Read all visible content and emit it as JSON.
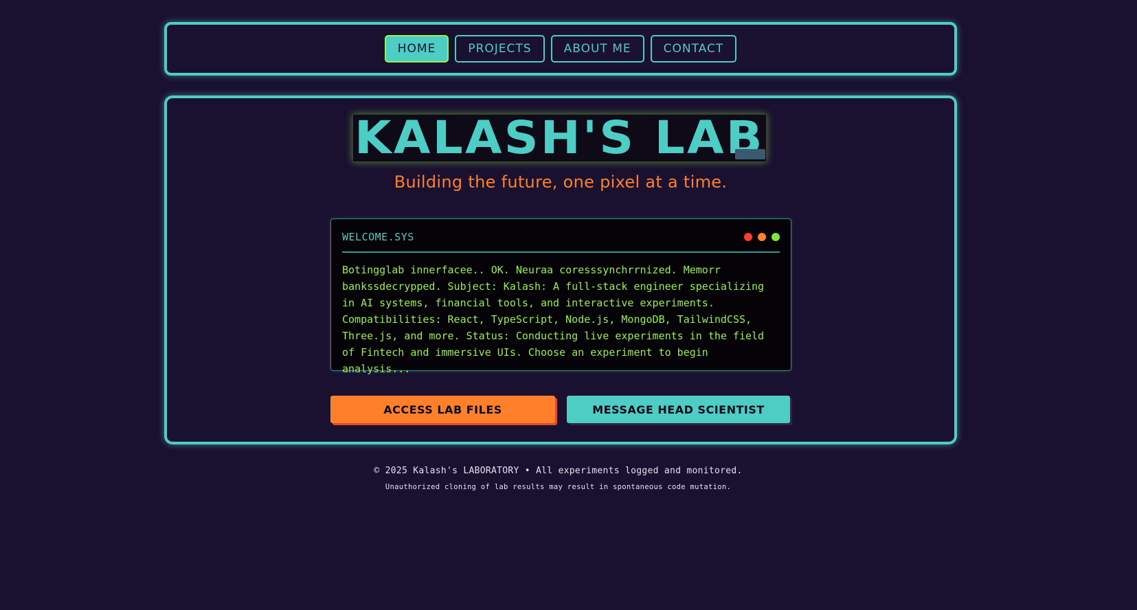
{
  "nav": {
    "items": [
      {
        "label": "HOME",
        "active": true
      },
      {
        "label": "PROJECTS",
        "active": false
      },
      {
        "label": "ABOUT ME",
        "active": false
      },
      {
        "label": "CONTACT",
        "active": false
      }
    ]
  },
  "hero": {
    "title": "KALASH'S LAB",
    "tagline": "Building the future, one pixel at a time."
  },
  "terminal": {
    "title": "WELCOME.SYS",
    "dot_colors": [
      "#ff3b30",
      "#ff7f2a",
      "#7ee83a"
    ],
    "body": "Botingglab innerfacee.. OK. Neuraa coresssynchrrnized. Memorr bankssdecrypped. Subject: Kalash: A full-stack engineer specializing in AI systems, financial tools, and interactive experiments. Compatibilities: React, TypeScript, Node.js, MongoDB, TailwindCSS, Three.js, and more. Status: Conducting live experiments in the field of Fintech and immersive UIs. Choose an experiment to begin analysis..."
  },
  "actions": {
    "primary_label": "ACCESS LAB FILES",
    "secondary_label": "MESSAGE HEAD SCIENTIST"
  },
  "footer": {
    "copyright": "© 2025 Kalash's LABORATORY • All experiments logged and monitored.",
    "notice": "Unauthorized cloning of lab results may result in spontaneous code mutation."
  },
  "colors": {
    "background": "#1a1030",
    "accent_teal": "#4ecdc4",
    "accent_orange": "#ff7f2a",
    "terminal_green": "#9bf04a"
  }
}
